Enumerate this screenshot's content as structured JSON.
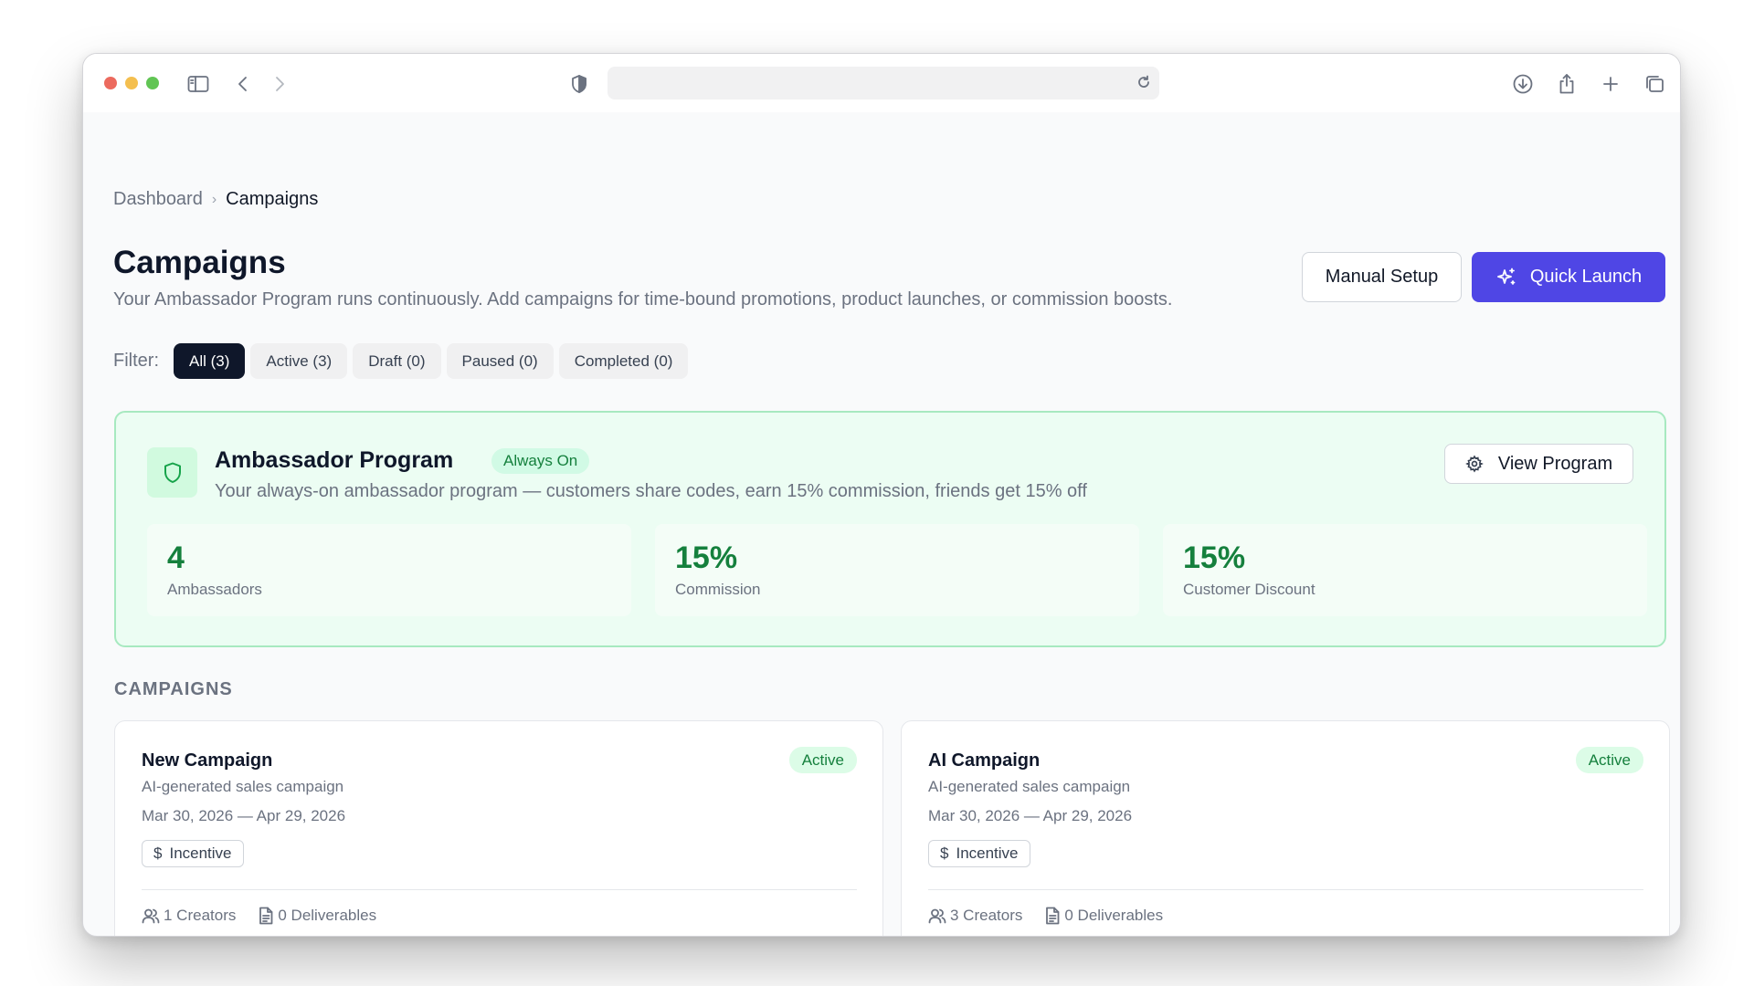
{
  "breadcrumb": {
    "parent": "Dashboard",
    "separator": "›",
    "current": "Campaigns"
  },
  "header": {
    "title": "Campaigns",
    "subtitle": "Your Ambassador Program runs continuously. Add campaigns for time-bound promotions, product launches, or commission boosts.",
    "manual_setup_label": "Manual Setup",
    "quick_launch_label": "Quick Launch"
  },
  "filters": {
    "label": "Filter:",
    "chips": [
      "All (3)",
      "Active (3)",
      "Draft (0)",
      "Paused (0)",
      "Completed (0)"
    ],
    "selected": "All (3)"
  },
  "ambassador": {
    "title": "Ambassador Program",
    "badge": "Always On",
    "description": "Your always-on ambassador program — customers share codes, earn 15% commission, friends get 15% off",
    "view_button": "View Program",
    "stats": [
      {
        "value": "4",
        "label": "Ambassadors"
      },
      {
        "value": "15%",
        "label": "Commission"
      },
      {
        "value": "15%",
        "label": "Customer Discount"
      }
    ]
  },
  "campaigns_heading": "CAMPAIGNS",
  "campaigns": [
    {
      "title": "New Campaign",
      "status": "Active",
      "description": "AI-generated sales campaign",
      "dates": "Mar 30, 2026 — Apr 29, 2026",
      "tag": "Incentive",
      "creators": "1 Creators",
      "deliverables": "0 Deliverables"
    },
    {
      "title": "AI Campaign",
      "status": "Active",
      "description": "AI-generated sales campaign",
      "dates": "Mar 30, 2026 — Apr 29, 2026",
      "tag": "Incentive",
      "creators": "3 Creators",
      "deliverables": "0 Deliverables"
    }
  ],
  "colors": {
    "primary": "#4f46e5",
    "success": "#15803d",
    "ambassador_bg": "#ecfdf3",
    "ambassador_border": "#a7e9c0"
  }
}
